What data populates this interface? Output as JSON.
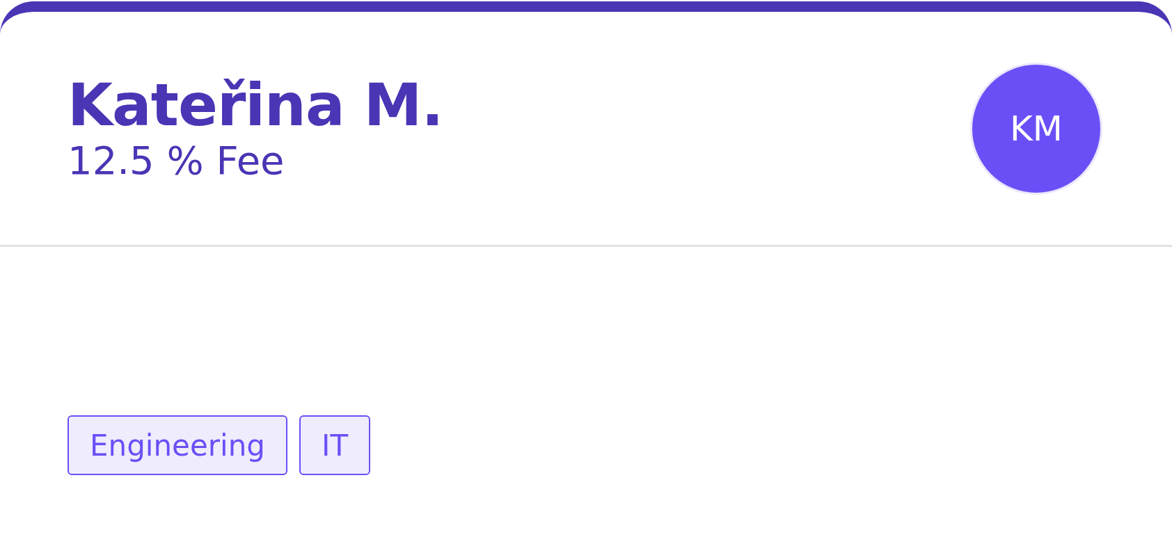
{
  "profile": {
    "name": "Kateřina M.",
    "fee": "12.5 % Fee",
    "avatar_initials": "KM"
  },
  "tags": [
    {
      "label": "Engineering"
    },
    {
      "label": "IT"
    }
  ]
}
